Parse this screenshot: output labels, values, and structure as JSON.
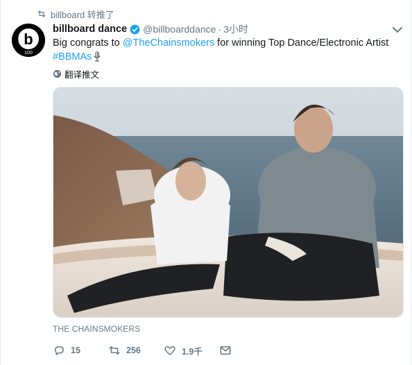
{
  "retweet": {
    "label": "billboard 转推了"
  },
  "author": {
    "display_name": "billboard dance",
    "handle": "@billboarddance",
    "separator": "·",
    "timestamp": "3小时",
    "avatar_letter": "b",
    "avatar_text_dance": "DANCE",
    "avatar_text_100": "100"
  },
  "tweet": {
    "text_prefix": "Big congrats to ",
    "mention": "@TheChainsmokers",
    "text_suffix": " for winning Top Dance/Electronic Artist",
    "hashtag": "#BBMAs"
  },
  "translate": {
    "label": "翻译推文"
  },
  "media": {
    "caption": "THE CHAINSMOKERS"
  },
  "actions": {
    "reply_count": "15",
    "retweet_count": "256",
    "like_count": "1.9千"
  },
  "colors": {
    "accent": "#1da1f2",
    "muted": "#657786",
    "text": "#14171a"
  }
}
